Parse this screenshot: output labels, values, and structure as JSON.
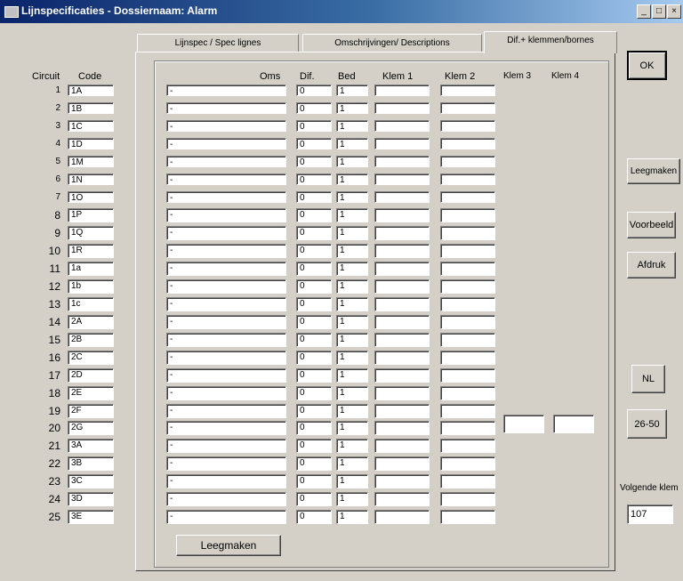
{
  "window": {
    "title": "Lijnspecificaties - Dossiernaam: Alarm",
    "controls": [
      "_",
      "□",
      "×"
    ]
  },
  "tabs": [
    {
      "label": "Lijnspec / Spec lignes"
    },
    {
      "label": "Omschrijvingen/ Descriptions"
    },
    {
      "label": "Dif.+ klemmen/bornes"
    }
  ],
  "left_headers": {
    "circuit": "Circuit",
    "code": "Code"
  },
  "columns": {
    "omschrijving": "Oms",
    "dif": "Dif.",
    "bed": "Bed",
    "klem1": "Klem 1",
    "klem2": "Klem 2",
    "klem3": "Klem 3",
    "klem4": "Klem 4"
  },
  "rows": [
    {
      "n": "1",
      "code": "1A",
      "oms": "-",
      "dif": "0",
      "bed": "1"
    },
    {
      "n": "2",
      "code": "1B",
      "oms": "-",
      "dif": "0",
      "bed": "1"
    },
    {
      "n": "3",
      "code": "1C",
      "oms": "-",
      "dif": "0",
      "bed": "1"
    },
    {
      "n": "4",
      "code": "1D",
      "oms": "-",
      "dif": "0",
      "bed": "1"
    },
    {
      "n": "5",
      "code": "1M",
      "oms": "-",
      "dif": "0",
      "bed": "1"
    },
    {
      "n": "6",
      "code": "1N",
      "oms": "-",
      "dif": "0",
      "bed": "1"
    },
    {
      "n": "7",
      "code": "1O",
      "oms": "-",
      "dif": "0",
      "bed": "1"
    },
    {
      "n": "8",
      "code": "1P",
      "oms": "-",
      "dif": "0",
      "bed": "1"
    },
    {
      "n": "9",
      "code": "1Q",
      "oms": "-",
      "dif": "0",
      "bed": "1"
    },
    {
      "n": "10",
      "code": "1R",
      "oms": "-",
      "dif": "0",
      "bed": "1"
    },
    {
      "n": "11",
      "code": "1a",
      "oms": "-",
      "dif": "0",
      "bed": "1"
    },
    {
      "n": "12",
      "code": "1b",
      "oms": "-",
      "dif": "0",
      "bed": "1"
    },
    {
      "n": "13",
      "code": "1c",
      "oms": "-",
      "dif": "0",
      "bed": "1"
    },
    {
      "n": "14",
      "code": "2A",
      "oms": "-",
      "dif": "0",
      "bed": "1"
    },
    {
      "n": "15",
      "code": "2B",
      "oms": "-",
      "dif": "0",
      "bed": "1"
    },
    {
      "n": "16",
      "code": "2C",
      "oms": "-",
      "dif": "0",
      "bed": "1"
    },
    {
      "n": "17",
      "code": "2D",
      "oms": "-",
      "dif": "0",
      "bed": "1"
    },
    {
      "n": "18",
      "code": "2E",
      "oms": "-",
      "dif": "0",
      "bed": "1"
    },
    {
      "n": "19",
      "code": "2F",
      "oms": "-",
      "dif": "0",
      "bed": "1"
    },
    {
      "n": "20",
      "code": "2G",
      "oms": "-",
      "dif": "0",
      "bed": "1"
    },
    {
      "n": "21",
      "code": "3A",
      "oms": "-",
      "dif": "0",
      "bed": "1"
    },
    {
      "n": "22",
      "code": "3B",
      "oms": "-",
      "dif": "0",
      "bed": "1"
    },
    {
      "n": "23",
      "code": "3C",
      "oms": "-",
      "dif": "0",
      "bed": "1"
    },
    {
      "n": "24",
      "code": "3D",
      "oms": "-",
      "dif": "0",
      "bed": "1"
    },
    {
      "n": "25",
      "code": "3E",
      "oms": "-",
      "dif": "0",
      "bed": "1"
    }
  ],
  "bottom_button": "Leegmaken",
  "side": {
    "ok": "OK",
    "leegmaken": "Leegmaken",
    "voorbeeld": "Voorbeeld",
    "afdruk": "Afdruk",
    "nl": "NL",
    "range": "26-50",
    "volgende_label": "Volgende klem",
    "volgende_value": "107"
  }
}
